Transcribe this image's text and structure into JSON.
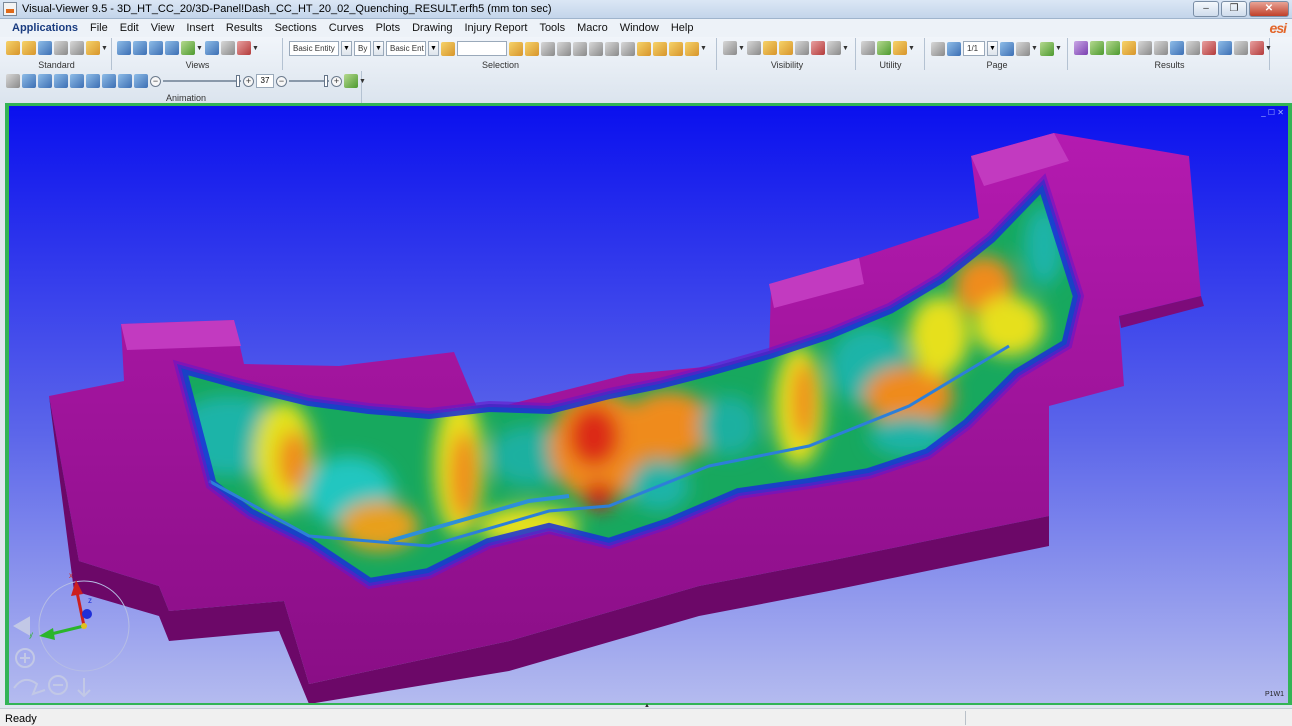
{
  "window": {
    "title": "Visual-Viewer 9.5 - 3D_HT_CC_20/3D-Panel!Dash_CC_HT_20_02_Quenching_RESULT.erfh5 (mm ton sec)",
    "minimize": "–",
    "maximize": "❐",
    "close": "✕"
  },
  "menubar": {
    "items": [
      "Applications",
      "File",
      "Edit",
      "View",
      "Insert",
      "Results",
      "Sections",
      "Curves",
      "Plots",
      "Drawing",
      "Injury Report",
      "Tools",
      "Macro",
      "Window",
      "Help"
    ],
    "logo": "esi"
  },
  "toolbar": {
    "groups": {
      "standard": "Standard",
      "views": "Views",
      "selection": "Selection",
      "visibility": "Visibility",
      "utility": "Utility",
      "page": "Page",
      "results": "Results",
      "animation": "Animation"
    },
    "selection": {
      "entity_combo": "Basic Entity",
      "by_combo": "By",
      "entity_combo2": "Basic Ent",
      "search_value": ""
    },
    "page": {
      "page_combo": "1/1"
    },
    "animation": {
      "frame": "37"
    }
  },
  "viewport": {
    "page_tag": "P1W1",
    "ctrls": "_ ☐ ✕",
    "triad": {
      "x_label": "x",
      "y_label": "y",
      "z_label": "z"
    },
    "colors": {
      "background_top": "#0a10ee",
      "background_bottom": "#b4bbef",
      "die": "#a0129e",
      "die_dark": "#6c0868"
    }
  },
  "statusbar": {
    "status": "Ready"
  }
}
